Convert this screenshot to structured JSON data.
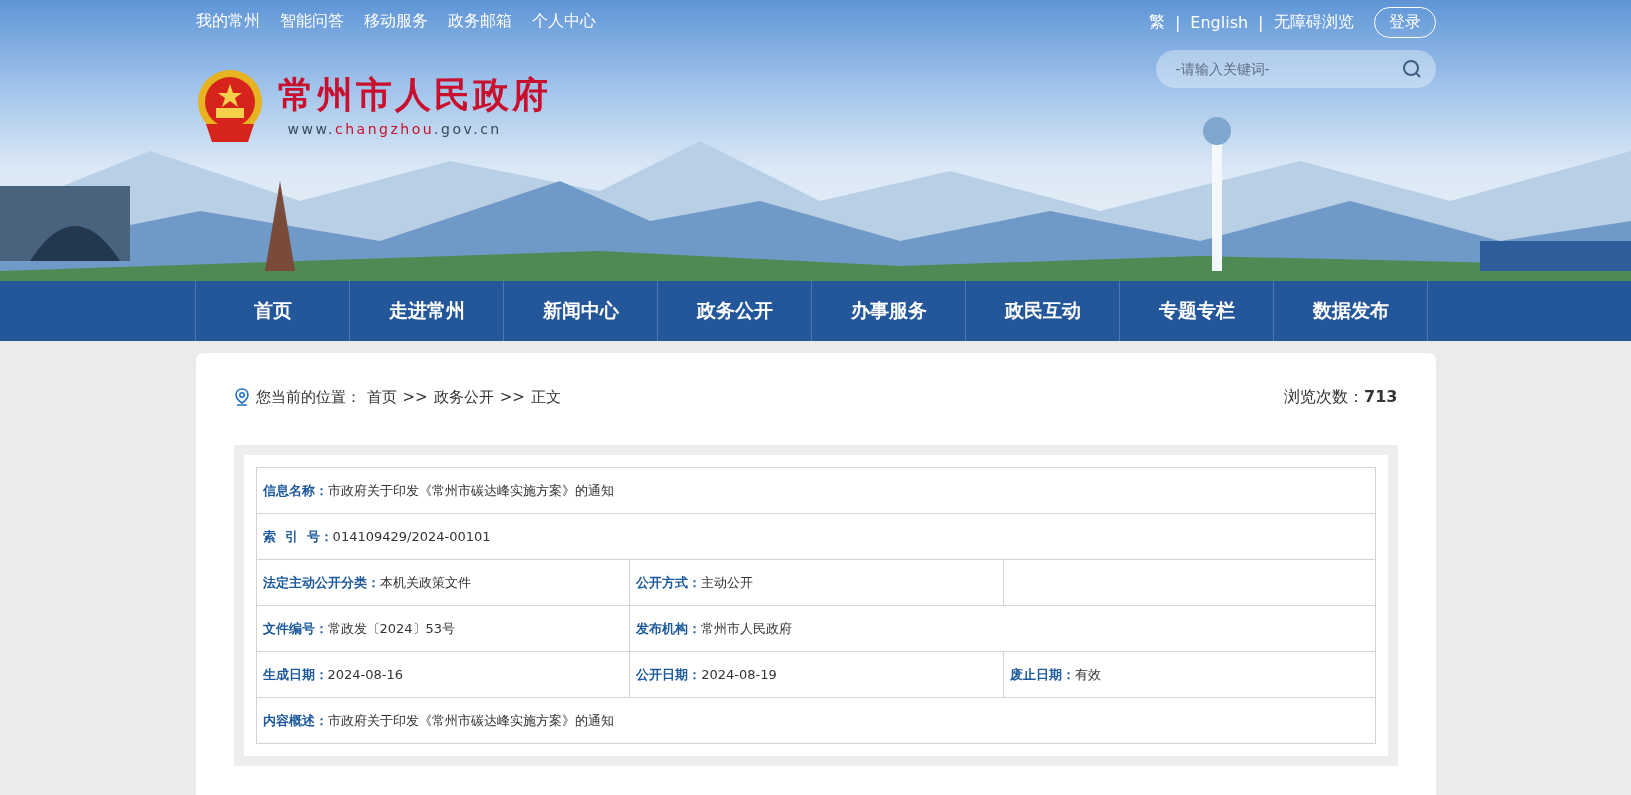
{
  "top_links": [
    "我的常州",
    "智能问答",
    "移动服务",
    "政务邮箱",
    "个人中心"
  ],
  "top_right": {
    "links": [
      "繁",
      "English",
      "无障碍浏览"
    ],
    "dividers": [
      "|",
      "|"
    ],
    "login": "登录"
  },
  "search": {
    "placeholder": "-请输入关键词-"
  },
  "site": {
    "title": "常州市人民政府",
    "url_prefix": "www.",
    "url_domain": "changzhou",
    "url_suffix": ".gov.cn"
  },
  "nav": [
    {
      "label": "首页",
      "selected": false
    },
    {
      "label": "走进常州",
      "selected": false
    },
    {
      "label": "新闻中心",
      "selected": false
    },
    {
      "label": "政务公开",
      "selected": false
    },
    {
      "label": "办事服务",
      "selected": false
    },
    {
      "label": "政民互动",
      "selected": false
    },
    {
      "label": "专题专栏",
      "selected": false
    },
    {
      "label": "数据发布",
      "selected": false
    }
  ],
  "breadcrumb": {
    "label": "您当前的位置：",
    "crumbs": [
      "首页",
      "政务公开",
      "正文"
    ],
    "separators": [
      ">>",
      ">>"
    ]
  },
  "views": {
    "label": "浏览次数：",
    "value": "713"
  },
  "info_table": {
    "rows": [
      {
        "cells": [
          {
            "kind": "field",
            "colspan": 3,
            "label": "信息名称：",
            "value": "市政府关于印发《常州市碳达峰实施方案》的通知"
          }
        ]
      },
      {
        "cells": [
          {
            "kind": "field",
            "colspan": 3,
            "label": "索  引  号：",
            "value": "014109429/2024-00101"
          }
        ]
      },
      {
        "cells": [
          {
            "kind": "field",
            "label": "法定主动公开分类：",
            "value": "本机关政策文件"
          },
          {
            "kind": "field",
            "label": "公开方式：",
            "value": "主动公开"
          },
          {
            "kind": "blank"
          }
        ]
      },
      {
        "cells": [
          {
            "kind": "field",
            "label": "文件编号：",
            "value": "常政发〔2024〕53号"
          },
          {
            "kind": "field",
            "colspan": 2,
            "label": "发布机构：",
            "value": "常州市人民政府"
          }
        ]
      },
      {
        "cells": [
          {
            "kind": "field",
            "label": "生成日期：",
            "value": "2024-08-16"
          },
          {
            "kind": "field",
            "label": "公开日期：",
            "value": "2024-08-19"
          },
          {
            "kind": "field",
            "label": "废止日期：",
            "value": "有效"
          }
        ]
      },
      {
        "cells": [
          {
            "kind": "field",
            "colspan": 3,
            "label": "内容概述：",
            "value": "市政府关于印发《常州市碳达峰实施方案》的通知"
          }
        ]
      }
    ]
  }
}
